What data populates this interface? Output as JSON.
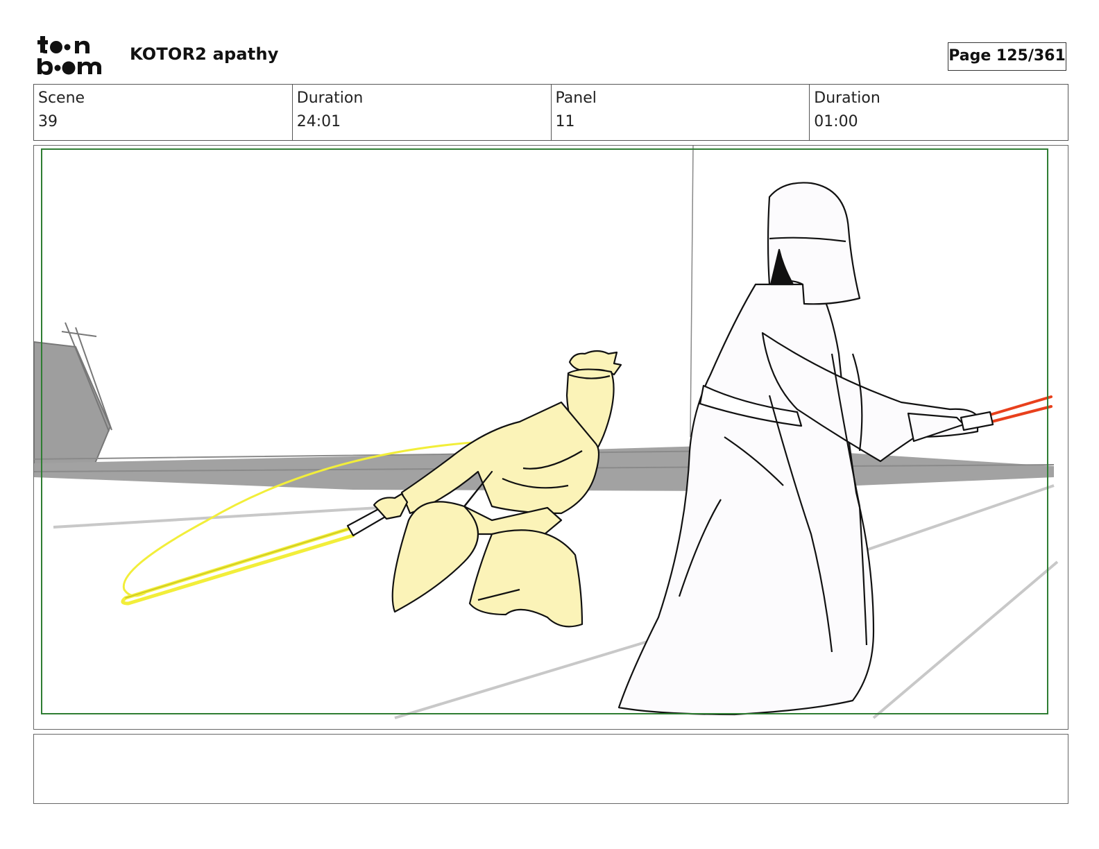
{
  "header": {
    "logo_icon": "toonboom-logo",
    "project_title": "KOTOR2 apathy",
    "page_indicator": "Page 125/361"
  },
  "info": [
    {
      "label": "Scene",
      "value": "39"
    },
    {
      "label": "Duration",
      "value": "24:01"
    },
    {
      "label": "Panel",
      "value": "11"
    },
    {
      "label": "Duration",
      "value": "01:00"
    }
  ],
  "panel": {
    "safe_frame_color": "#2e7d32",
    "jedi_fill_color": "#fbf3b8",
    "blue_saber_color": "#f2ee3a",
    "red_saber_color": "#e8401c",
    "ground_color": "#9e9e9e"
  },
  "caption": ""
}
